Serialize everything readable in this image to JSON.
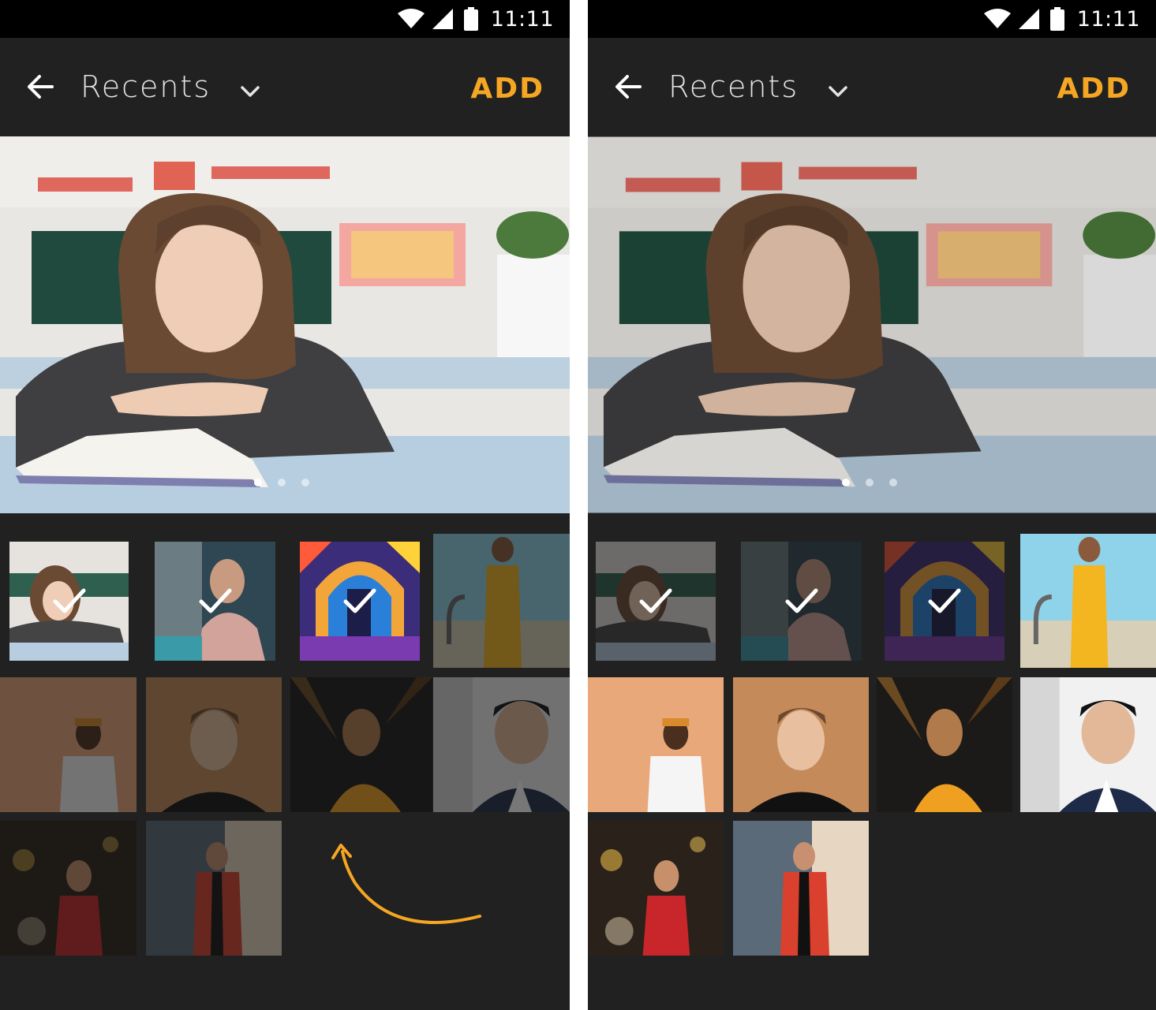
{
  "screens": [
    {
      "status": {
        "time": "11:11"
      },
      "app_bar": {
        "title": "Recents",
        "action": "ADD"
      },
      "preview": {
        "page_index": 1,
        "page_count": 3
      },
      "grid": [
        {
          "selected": true
        },
        {
          "selected": true
        },
        {
          "selected": true
        },
        {
          "selected": false
        },
        {
          "selected": false
        },
        {
          "selected": false
        },
        {
          "selected": false
        },
        {
          "selected": false
        },
        {
          "selected": false
        },
        {
          "selected": false
        }
      ],
      "unselected_dimmed": true
    },
    {
      "status": {
        "time": "11:11"
      },
      "app_bar": {
        "title": "Recents",
        "action": "ADD"
      },
      "preview": {
        "page_index": 1,
        "page_count": 3
      },
      "grid": [
        {
          "selected": true
        },
        {
          "selected": true
        },
        {
          "selected": true
        },
        {
          "selected": false
        },
        {
          "selected": false
        },
        {
          "selected": false
        },
        {
          "selected": false
        },
        {
          "selected": false
        },
        {
          "selected": false
        },
        {
          "selected": false
        }
      ],
      "unselected_dimmed": false
    }
  ],
  "icons": {
    "wifi": "wifi-icon",
    "signal": "cell-signal-icon",
    "battery": "battery-icon",
    "back": "back-arrow-icon",
    "dropdown": "chevron-down-icon",
    "check": "checkmark-icon"
  },
  "colors": {
    "accent": "#f5a623",
    "background": "#212121",
    "status_bar": "#000000"
  }
}
